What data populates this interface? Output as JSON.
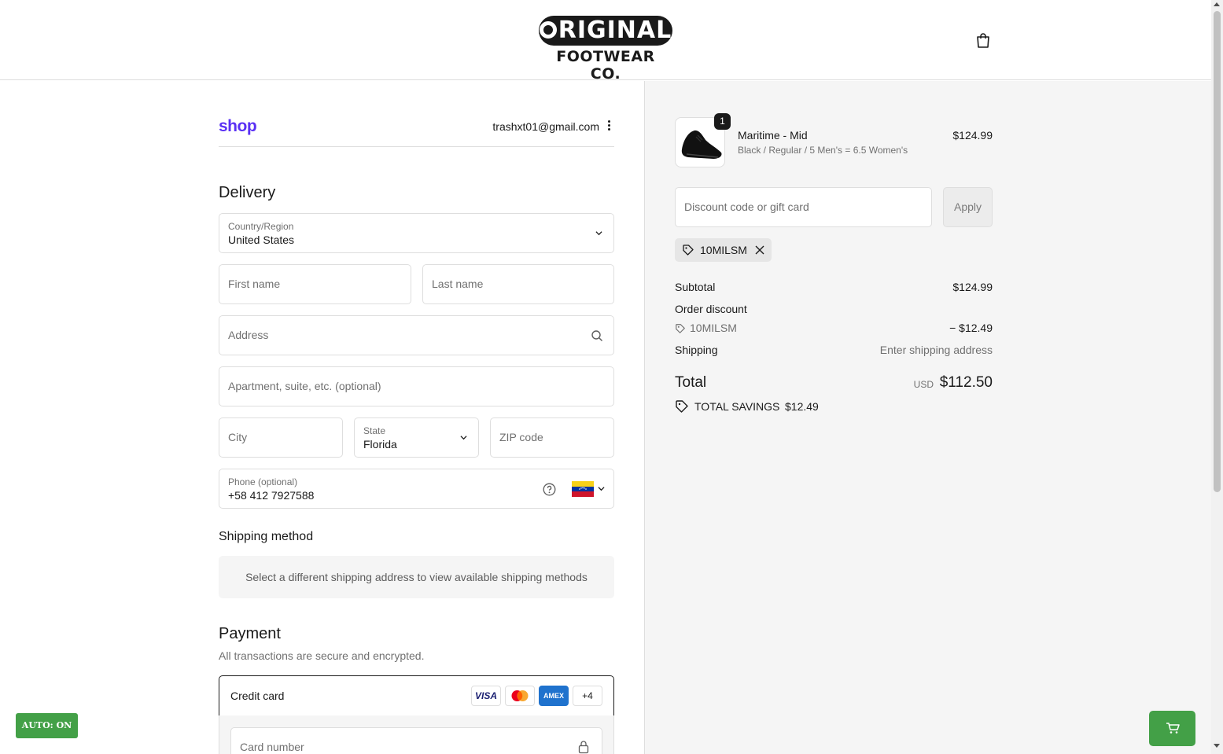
{
  "header": {
    "logo_main": "RIGINAL",
    "logo_sub": "FOOTWEAR CO.",
    "cart_icon": "shopping-bag-icon"
  },
  "account": {
    "shop_label": "shop",
    "email": "trashxt01@gmail.com"
  },
  "delivery": {
    "heading": "Delivery",
    "country": {
      "label": "Country/Region",
      "value": "United States"
    },
    "first_name": {
      "placeholder": "First name",
      "value": ""
    },
    "last_name": {
      "placeholder": "Last name",
      "value": ""
    },
    "address": {
      "placeholder": "Address",
      "value": ""
    },
    "apartment": {
      "placeholder": "Apartment, suite, etc. (optional)",
      "value": ""
    },
    "city": {
      "placeholder": "City",
      "value": ""
    },
    "state": {
      "label": "State",
      "value": "Florida"
    },
    "zip": {
      "placeholder": "ZIP code",
      "value": ""
    },
    "phone": {
      "label": "Phone (optional)",
      "value": "+58 412 7927588",
      "flag": "venezuela-flag-icon"
    }
  },
  "shipping_method": {
    "heading": "Shipping method",
    "note": "Select a different shipping address to view available shipping methods"
  },
  "payment": {
    "heading": "Payment",
    "subtitle": "All transactions are secure and encrypted.",
    "method": "Credit card",
    "brands": [
      "VISA",
      "",
      "AMEX",
      "+4"
    ],
    "card_number_placeholder": "Card number"
  },
  "order": {
    "item": {
      "quantity": "1",
      "name": "Maritime - Mid",
      "variant": "Black / Regular / 5 Men's = 6.5 Women's",
      "price": "$124.99"
    },
    "discount_placeholder": "Discount code or gift card",
    "apply_label": "Apply",
    "applied_code": "10MILSM",
    "subtotal_label": "Subtotal",
    "subtotal_value": "$124.99",
    "order_discount_label": "Order discount",
    "discount_code": "10MILSM",
    "discount_value": "− $12.49",
    "shipping_label": "Shipping",
    "shipping_value": "Enter shipping address",
    "total_label": "Total",
    "currency": "USD",
    "total_value": "$112.50",
    "savings_label": "TOTAL SAVINGS",
    "savings_value": "$12.49"
  },
  "overlay": {
    "auto_label": "AUTO: ON"
  },
  "colors": {
    "shop_brand": "#5a31f4",
    "auto_button": "#43a047",
    "summary_bg": "#f5f5f5"
  }
}
